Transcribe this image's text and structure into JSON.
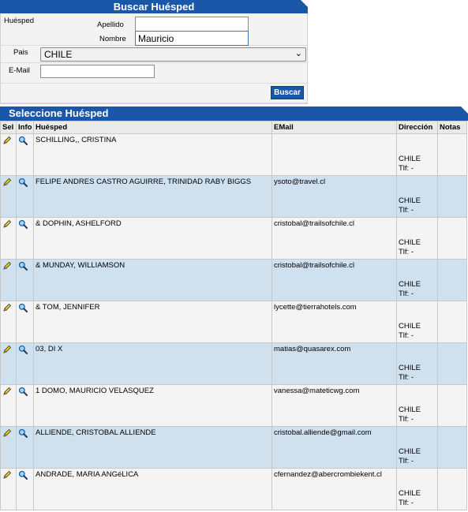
{
  "search": {
    "title": "Buscar Huésped",
    "huesped_label": "Huésped",
    "apellido_label": "Apellido",
    "apellido_value": "",
    "nombre_label": "Nombre",
    "nombre_value": "Mauricio",
    "pais_label": "Pais",
    "pais_value": "CHILE",
    "email_label": "E-Mail",
    "email_value": "",
    "search_button": "Buscar"
  },
  "results": {
    "title": "Seleccione Huésped",
    "columns": [
      "Sel",
      "Info",
      "Huésped",
      "EMail",
      "Dirección",
      "Notas"
    ],
    "rows": [
      {
        "name": "SCHILLING,, CRISTINA",
        "email": "",
        "country": "CHILE",
        "phone": "Tlf: -"
      },
      {
        "name": "FELIPE ANDRES CASTRO AGUIRRE, TRINIDAD RABY BIGGS",
        "email": "ysoto@travel.cl",
        "country": "CHILE",
        "phone": "Tlf: -"
      },
      {
        "name": "& DOPHIN, ASHELFORD",
        "email": "cristobal@trailsofchile.cl",
        "country": "CHILE",
        "phone": "Tlf: -"
      },
      {
        "name": "& MUNDAY, WILLIAMSON",
        "email": "cristobal@trailsofchile.cl",
        "country": "CHILE",
        "phone": "Tlf: -"
      },
      {
        "name": "& TOM, JENNIFER",
        "email": "lycette@tierrahotels.com",
        "country": "CHILE",
        "phone": "Tlf: -"
      },
      {
        "name": "03, DI X",
        "email": "matias@quasarex.com",
        "country": "CHILE",
        "phone": "Tlf: -"
      },
      {
        "name": "1 DOMO, MAURICIO VELASQUEZ",
        "email": "vanessa@mateticwg.com",
        "country": "CHILE",
        "phone": "Tlf: -"
      },
      {
        "name": "ALLIENDE, CRISTOBAL ALLIENDE",
        "email": "cristobal.alliende@gmail.com",
        "country": "CHILE",
        "phone": "Tlf: -"
      },
      {
        "name": "ANDRADE, MARIA ANGéLICA",
        "email": "cfernandez@abercrombiekent.cl",
        "country": "CHILE",
        "phone": "Tlf: -"
      }
    ]
  },
  "icons": {
    "select": "pencil-icon",
    "info": "magnifier-icon"
  },
  "colors": {
    "header_blue": "#1b57a8",
    "row_alt": "#cfe0ef",
    "row": "#f4f4f4"
  }
}
